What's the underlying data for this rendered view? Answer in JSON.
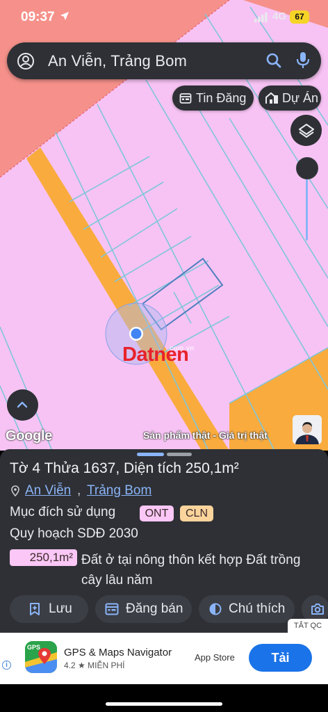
{
  "status_bar": {
    "time": "09:37",
    "network": "4G",
    "battery": "67"
  },
  "search": {
    "query": "An Viễn, Trảng Bom"
  },
  "chips": {
    "tin_dang": "Tin Đăng",
    "du_an": "Dự Án"
  },
  "map": {
    "watermark_brand": "Datnen",
    "watermark_domain": ".com.vn",
    "attribution": "Google",
    "tagline": "Sản phẩm thật - Giá trị thật",
    "colors": {
      "residential_pink": "#f7c3f4",
      "perennial_orange": "#f9ab3e",
      "salmon": "#f5918a",
      "parcel_line": "#7fc6d9"
    }
  },
  "parcel": {
    "title": "Tờ 4 Thửa 1637, Diện tích 250,1m²",
    "commune": "An Viễn",
    "separator": ",",
    "district": "Trảng Bom",
    "purpose_label": "Mục đích sử dụng",
    "tags": [
      "ONT",
      "CLN"
    ],
    "plan_label": "Quy hoạch SDĐ 2030",
    "area": "250,1m²",
    "land_description": "Đất ở tại nông thôn kết hợp Đất trồng cây lâu năm"
  },
  "actions": {
    "save": "Lưu",
    "post_sale": "Đăng bán",
    "legend": "Chú thích"
  },
  "ad": {
    "close_label": "TẮT QC",
    "info": "i",
    "app_name": "GPS & Maps Navigator",
    "rating": "4.2 ★  MIỄN PHÍ",
    "store": "App Store",
    "install": "Tải",
    "icon_label": "GPS"
  }
}
